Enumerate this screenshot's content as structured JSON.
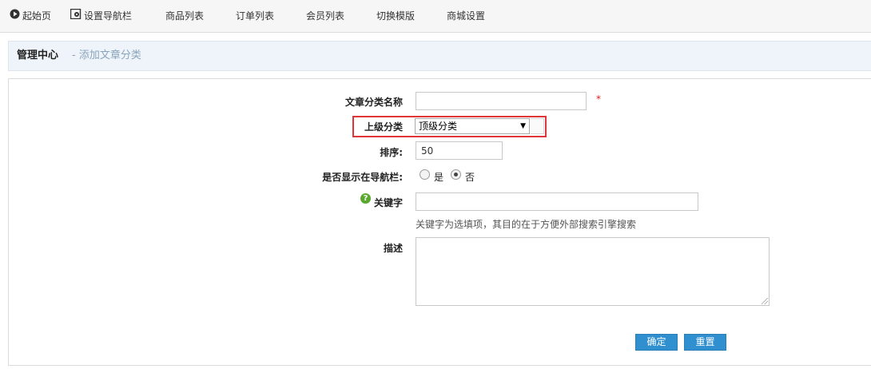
{
  "topnav": {
    "start_label": "起始页",
    "set_nav_label": "设置导航栏",
    "goods_label": "商品列表",
    "orders_label": "订单列表",
    "members_label": "会员列表",
    "template_label": "切换模版",
    "settings_label": "商城设置"
  },
  "breadcrumb": {
    "main": "管理中心",
    "sub": "- 添加文章分类"
  },
  "form": {
    "name_label": "文章分类名称",
    "name_value": "",
    "required_mark": "*",
    "parent_label": "上级分类",
    "parent_selected": "顶级分类",
    "sort_label": "排序:",
    "sort_value": "50",
    "show_nav_label": "是否显示在导航栏:",
    "show_nav_options": [
      "是",
      "否"
    ],
    "show_nav_selected": "否",
    "keywords_label": "关键字",
    "keywords_value": "",
    "keywords_hint": "关键字为选填项，其目的在于方便外部搜索引擎搜索",
    "desc_label": "描述",
    "desc_value": ""
  },
  "buttons": {
    "confirm": "确定",
    "reset": "重置"
  }
}
